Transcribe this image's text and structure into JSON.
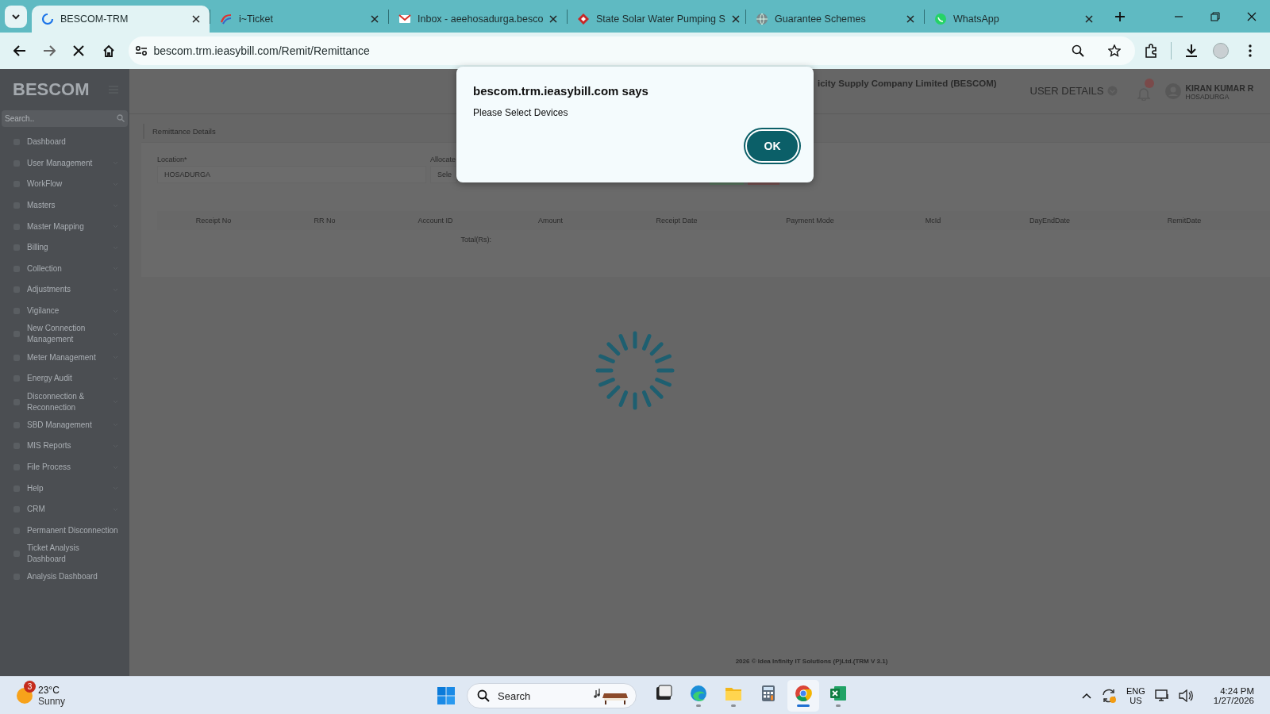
{
  "browser": {
    "tabs": [
      {
        "title": "BESCOM-TRM",
        "selected": true,
        "kind": "loading"
      },
      {
        "title": "i~Ticket",
        "selected": false,
        "kind": "swoosh"
      },
      {
        "title": "Inbox - aeehosadurga.besco",
        "selected": false,
        "kind": "mail"
      },
      {
        "title": "State Solar Water Pumping S",
        "selected": false,
        "kind": "diamond"
      },
      {
        "title": "Guarantee Schemes",
        "selected": false,
        "kind": "globe"
      },
      {
        "title": "WhatsApp",
        "selected": false,
        "kind": "chat"
      }
    ],
    "url": "bescom.trm.ieasybill.com/Remit/Remittance"
  },
  "sidebar": {
    "logo": "BESCOM",
    "search": {
      "placeholder": "Search.."
    },
    "items": [
      {
        "label": "Dashboard",
        "expandable": false
      },
      {
        "label": "User Management",
        "expandable": true
      },
      {
        "label": "WorkFlow",
        "expandable": true
      },
      {
        "label": "Masters",
        "expandable": true
      },
      {
        "label": "Master Mapping",
        "expandable": true
      },
      {
        "label": "Billing",
        "expandable": true
      },
      {
        "label": "Collection",
        "expandable": true
      },
      {
        "label": "Adjustments",
        "expandable": true
      },
      {
        "label": "Vigilance",
        "expandable": true
      },
      {
        "label": "New Connection Management",
        "expandable": true
      },
      {
        "label": "Meter Management",
        "expandable": true
      },
      {
        "label": "Energy Audit",
        "expandable": true
      },
      {
        "label": "Disconnection & Reconnection",
        "expandable": true
      },
      {
        "label": "SBD Management",
        "expandable": true
      },
      {
        "label": "MIS Reports",
        "expandable": true
      },
      {
        "label": "File Process",
        "expandable": true
      },
      {
        "label": "Help",
        "expandable": true
      },
      {
        "label": "CRM",
        "expandable": true
      },
      {
        "label": "Permanent Disconnection",
        "expandable": false
      },
      {
        "label": "Ticket Analysis Dashboard",
        "expandable": false
      },
      {
        "label": "Analysis Dashboard",
        "expandable": false
      }
    ]
  },
  "header": {
    "title": "icity Supply Company Limited (BESCOM)",
    "user_menu": "USER DETAILS",
    "user": {
      "name": "KIRAN KUMAR R",
      "location": "HOSADURGA"
    }
  },
  "page": {
    "breadcrumb": "Remittance Details",
    "fields": [
      {
        "label": "Location*",
        "value": "HOSADURGA"
      },
      {
        "label": "Allocate",
        "placeholder": "Sele"
      }
    ],
    "table": {
      "columns": [
        "Receipt No",
        "RR No",
        "Account ID",
        "Amount",
        "Receipt Date",
        "Payment Mode",
        "McId",
        "DayEndDate",
        "RemitDate"
      ],
      "total_label": "Total(Rs):"
    },
    "footer": "2026 © Idea Infinity IT Solutions (P)Ltd.(TRM V 3.1)"
  },
  "dialog": {
    "title": "bescom.trm.ieasybill.com says",
    "message": "Please Select Devices",
    "button": "OK"
  },
  "taskbar": {
    "weather": {
      "badge": "3",
      "temperature": "23°C",
      "condition": "Sunny"
    },
    "search": {
      "label": "Search"
    },
    "apps": [
      {
        "kind": "taskview",
        "active": false,
        "running": false
      },
      {
        "kind": "edge",
        "active": false,
        "running": true
      },
      {
        "kind": "folder",
        "active": false,
        "running": true
      },
      {
        "kind": "calculator",
        "active": false,
        "running": false
      },
      {
        "kind": "chrome",
        "active": true,
        "running": true
      },
      {
        "kind": "excel",
        "active": false,
        "running": true
      }
    ],
    "tray": {
      "language": "ENG",
      "region": "US",
      "time": "4:24 PM",
      "date": "1/27/2026"
    }
  }
}
